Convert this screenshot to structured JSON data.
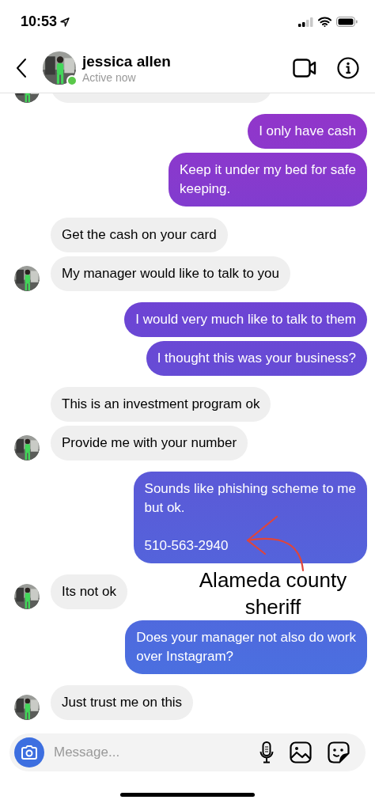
{
  "status_bar": {
    "time": "10:53"
  },
  "header": {
    "name": "jessica allen",
    "status": "Active now",
    "online": true
  },
  "messages": [
    {
      "kind": "incoming_cut",
      "avatar": true
    },
    {
      "kind": "outgoing",
      "text": "I only have cash"
    },
    {
      "kind": "outgoing",
      "text": "Keep it under my bed for safe\nkeeping."
    },
    {
      "kind": "incoming",
      "text": "Get the cash on your card",
      "avatar": false
    },
    {
      "kind": "incoming",
      "text": "My manager would like to talk to you",
      "avatar": true
    },
    {
      "kind": "outgoing",
      "text": "I would very much like to talk to them"
    },
    {
      "kind": "outgoing",
      "text": "I thought this was your business?"
    },
    {
      "kind": "incoming",
      "text": "This is an investment program ok",
      "avatar": false
    },
    {
      "kind": "incoming",
      "text": "Provide me with your number",
      "avatar": true
    },
    {
      "kind": "outgoing",
      "text": "Sounds like phishing scheme to me\nbut ok.\n\n510-563-2940"
    },
    {
      "kind": "incoming",
      "text": "Its not ok",
      "avatar": true
    },
    {
      "kind": "outgoing",
      "text": "Does your manager not also do work\nover Instagram?"
    },
    {
      "kind": "incoming",
      "text": "Just trust me on this",
      "avatar": true
    }
  ],
  "annotation": {
    "text": "Alameda county sheriff"
  },
  "composer": {
    "placeholder": "Message..."
  }
}
